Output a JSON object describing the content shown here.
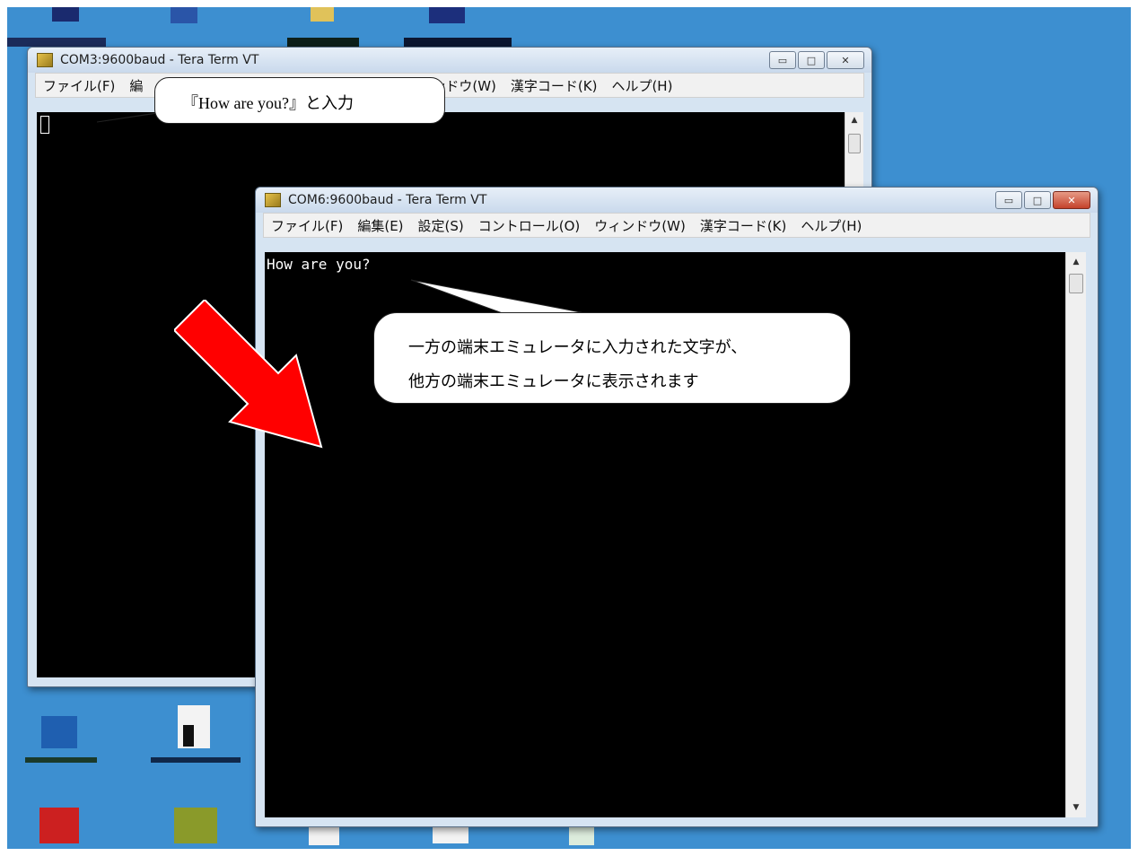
{
  "windows": {
    "back": {
      "title": "COM3:9600baud - Tera Term VT",
      "menu": [
        "ファイル(F)",
        "編",
        "ンドウ(W)",
        "漢字コード(K)",
        "ヘルプ(H)"
      ],
      "controls": {
        "minimize": "▭",
        "maximize": "□",
        "close": "✕"
      }
    },
    "front": {
      "title": "COM6:9600baud - Tera Term VT",
      "menu": [
        "ファイル(F)",
        "編集(E)",
        "設定(S)",
        "コントロール(O)",
        "ウィンドウ(W)",
        "漢字コード(K)",
        "ヘルプ(H)"
      ],
      "terminal_text": "How are you?",
      "controls": {
        "minimize": "▭",
        "maximize": "□",
        "close": "✕"
      }
    }
  },
  "callouts": {
    "input": "『How are you?』と入力",
    "explain_line1": "一方の端末エミュレータに入力された文字が、",
    "explain_line2": "他方の端末エミュレータに表示されます"
  },
  "colors": {
    "desktop": "#3d8fd0",
    "arrow": "#ff0000",
    "terminal_bg": "#000000"
  }
}
